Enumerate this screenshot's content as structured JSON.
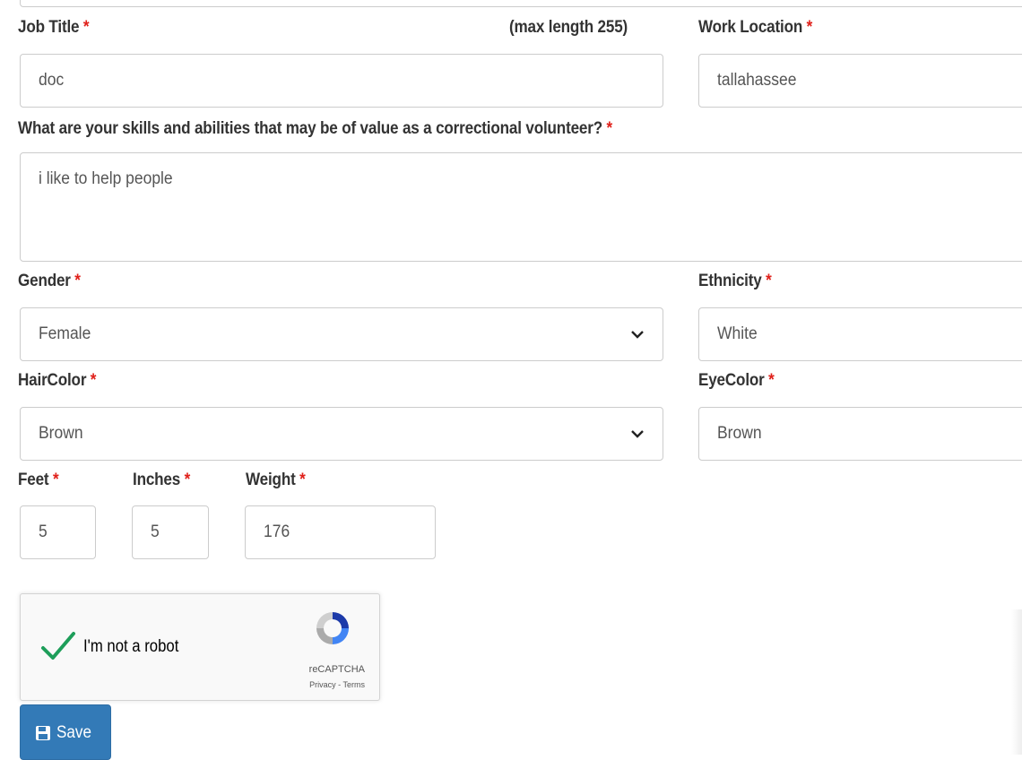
{
  "form": {
    "job_title": {
      "label": "Job Title",
      "required": "*",
      "hint": "(max length 255)",
      "value": "doc"
    },
    "work_location": {
      "label": "Work Location",
      "required": "*",
      "value": "tallahassee"
    },
    "skills": {
      "label": "What are your skills and abilities that may be of value as a correctional volunteer?",
      "required": "*",
      "value": "i like to help people"
    },
    "gender": {
      "label": "Gender",
      "required": "*",
      "selected": "Female"
    },
    "ethnicity": {
      "label": "Ethnicity",
      "required": "*",
      "selected": "White"
    },
    "hair_color": {
      "label": "HairColor",
      "required": "*",
      "selected": "Brown"
    },
    "eye_color": {
      "label": "EyeColor",
      "required": "*",
      "selected": "Brown"
    },
    "feet": {
      "label": "Feet",
      "required": "*",
      "value": "5"
    },
    "inches": {
      "label": "Inches",
      "required": "*",
      "value": "5"
    },
    "weight": {
      "label": "Weight",
      "required": "*",
      "value": "176"
    }
  },
  "captcha": {
    "label": "I'm not a robot",
    "brand": "reCAPTCHA",
    "links": "Privacy - Terms"
  },
  "save_button": {
    "label": "Save"
  },
  "icons": {
    "dropdown": "chevron-down-icon",
    "check": "checkmark-icon",
    "save": "floppy-disk-icon",
    "captcha_logo": "recaptcha-logo-icon"
  },
  "colors": {
    "required": "#e0201a",
    "primary": "#337ab7",
    "check": "#1e9e5a"
  }
}
